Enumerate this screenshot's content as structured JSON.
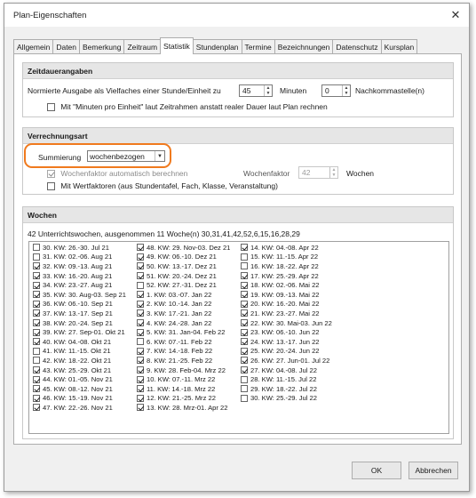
{
  "window": {
    "title": "Plan-Eigenschaften",
    "close_glyph": "✕"
  },
  "tabs": [
    "Allgemein",
    "Daten",
    "Bemerkung",
    "Zeitraum",
    "Statistik",
    "Stundenplan",
    "Termine",
    "Bezeichnungen",
    "Datenschutz",
    "Kursplan"
  ],
  "active_tab": "Statistik",
  "zeitdauer": {
    "heading": "Zeitdauerangaben",
    "normiert_label": "Normierte Ausgabe als Vielfaches einer Stunde/Einheit zu",
    "minuten_value": "45",
    "minuten_label": "Minuten",
    "nachkomma_value": "0",
    "nachkomma_label": "Nachkommastelle(n)",
    "mit_minuten_label": "Mit \"Minuten pro Einheit\" laut Zeitrahmen anstatt realer Dauer laut Plan rechnen",
    "mit_minuten_checked": false
  },
  "verrechnung": {
    "heading": "Verrechnungsart",
    "summierung_label": "Summierung",
    "summierung_value": "wochenbezogen",
    "wochenfaktor_auto_label": "Wochenfaktor automatisch berechnen",
    "wochenfaktor_auto_checked": true,
    "wochenfaktor_label": "Wochenfaktor",
    "wochenfaktor_value": "42",
    "wochen_label": "Wochen",
    "wertfaktoren_label": "Mit Wertfaktoren (aus Stundentafel, Fach, Klasse, Veranstaltung)",
    "wertfaktoren_checked": false
  },
  "wochen": {
    "heading": "Wochen",
    "summary": "42 Unterrichtswochen, ausgenommen 11 Woche(n) 30,31,41,42,52,6,15,16,28,29",
    "columns": [
      [
        {
          "label": "30. KW: 26.-30. Jul 21",
          "checked": false
        },
        {
          "label": "31. KW: 02.-06. Aug 21",
          "checked": false
        },
        {
          "label": "32. KW: 09.-13. Aug 21",
          "checked": true
        },
        {
          "label": "33. KW: 16.-20. Aug 21",
          "checked": true
        },
        {
          "label": "34. KW: 23.-27. Aug 21",
          "checked": true
        },
        {
          "label": "35. KW: 30. Aug-03. Sep 21",
          "checked": true
        },
        {
          "label": "36. KW: 06.-10. Sep 21",
          "checked": true
        },
        {
          "label": "37. KW: 13.-17. Sep 21",
          "checked": true
        },
        {
          "label": "38. KW: 20.-24. Sep 21",
          "checked": true
        },
        {
          "label": "39. KW: 27. Sep-01. Okt 21",
          "checked": true
        },
        {
          "label": "40. KW: 04.-08. Okt 21",
          "checked": true
        },
        {
          "label": "41. KW: 11.-15. Okt 21",
          "checked": false
        },
        {
          "label": "42. KW: 18.-22. Okt 21",
          "checked": false
        },
        {
          "label": "43. KW: 25.-29. Okt 21",
          "checked": true
        },
        {
          "label": "44. KW: 01.-05. Nov 21",
          "checked": true
        },
        {
          "label": "45. KW: 08.-12. Nov 21",
          "checked": true
        },
        {
          "label": "46. KW: 15.-19. Nov 21",
          "checked": true
        },
        {
          "label": "47. KW: 22.-26. Nov 21",
          "checked": true
        }
      ],
      [
        {
          "label": "48. KW: 29. Nov-03. Dez 21",
          "checked": true
        },
        {
          "label": "49. KW: 06.-10. Dez 21",
          "checked": true
        },
        {
          "label": "50. KW: 13.-17. Dez 21",
          "checked": true
        },
        {
          "label": "51. KW: 20.-24. Dez 21",
          "checked": true
        },
        {
          "label": "52. KW: 27.-31. Dez 21",
          "checked": false
        },
        {
          "label": "1. KW: 03.-07. Jan 22",
          "checked": true
        },
        {
          "label": "2. KW: 10.-14. Jan 22",
          "checked": true
        },
        {
          "label": "3. KW: 17.-21. Jan 22",
          "checked": true
        },
        {
          "label": "4. KW: 24.-28. Jan 22",
          "checked": true
        },
        {
          "label": "5. KW: 31. Jan-04. Feb 22",
          "checked": true
        },
        {
          "label": "6. KW: 07.-11. Feb 22",
          "checked": false
        },
        {
          "label": "7. KW: 14.-18. Feb 22",
          "checked": true
        },
        {
          "label": "8. KW: 21.-25. Feb 22",
          "checked": true
        },
        {
          "label": "9. KW: 28. Feb-04. Mrz 22",
          "checked": true
        },
        {
          "label": "10. KW: 07.-11. Mrz 22",
          "checked": true
        },
        {
          "label": "11. KW: 14.-18. Mrz 22",
          "checked": true
        },
        {
          "label": "12. KW: 21.-25. Mrz 22",
          "checked": true
        },
        {
          "label": "13. KW: 28. Mrz-01. Apr 22",
          "checked": true
        }
      ],
      [
        {
          "label": "14. KW: 04.-08. Apr 22",
          "checked": true
        },
        {
          "label": "15. KW: 11.-15. Apr 22",
          "checked": false
        },
        {
          "label": "16. KW: 18.-22. Apr 22",
          "checked": false
        },
        {
          "label": "17. KW: 25.-29. Apr 22",
          "checked": true
        },
        {
          "label": "18. KW: 02.-06. Mai 22",
          "checked": true
        },
        {
          "label": "19. KW: 09.-13. Mai 22",
          "checked": true
        },
        {
          "label": "20. KW: 16.-20. Mai 22",
          "checked": true
        },
        {
          "label": "21. KW: 23.-27. Mai 22",
          "checked": true
        },
        {
          "label": "22. KW: 30. Mai-03. Jun 22",
          "checked": true
        },
        {
          "label": "23. KW: 06.-10. Jun 22",
          "checked": true
        },
        {
          "label": "24. KW: 13.-17. Jun 22",
          "checked": true
        },
        {
          "label": "25. KW: 20.-24. Jun 22",
          "checked": true
        },
        {
          "label": "26. KW: 27. Jun-01. Jul 22",
          "checked": true
        },
        {
          "label": "27. KW: 04.-08. Jul 22",
          "checked": true
        },
        {
          "label": "28. KW: 11.-15. Jul 22",
          "checked": false
        },
        {
          "label": "29. KW: 18.-22. Jul 22",
          "checked": false
        },
        {
          "label": "30. KW: 25.-29. Jul 22",
          "checked": false
        }
      ]
    ]
  },
  "buttons": {
    "ok": "OK",
    "cancel": "Abbrechen"
  },
  "colors": {
    "highlight": "#f07a1e"
  }
}
